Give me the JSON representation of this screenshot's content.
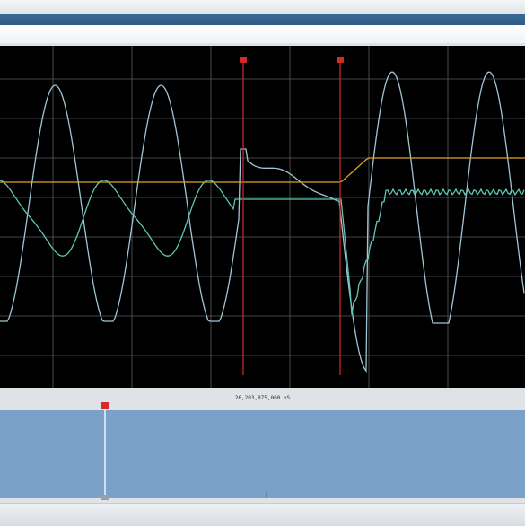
{
  "app": {
    "accent_color": "#2f5a86"
  },
  "scope": {
    "background": "#000000",
    "grid_color": "#5a5a5a",
    "cursor_color": "#d42a2a",
    "cursor_a_label": "",
    "cursor_b_label": "",
    "traces": [
      {
        "id": "voltage",
        "color": "#9fc6d6"
      },
      {
        "id": "current",
        "color": "#5ec8b6"
      },
      {
        "id": "digital",
        "color": "#e0a22a"
      }
    ]
  },
  "overview": {
    "timestamp": "26,203,875,000 nS",
    "fill_color": "#7aa1c8",
    "marker_label": ""
  }
}
